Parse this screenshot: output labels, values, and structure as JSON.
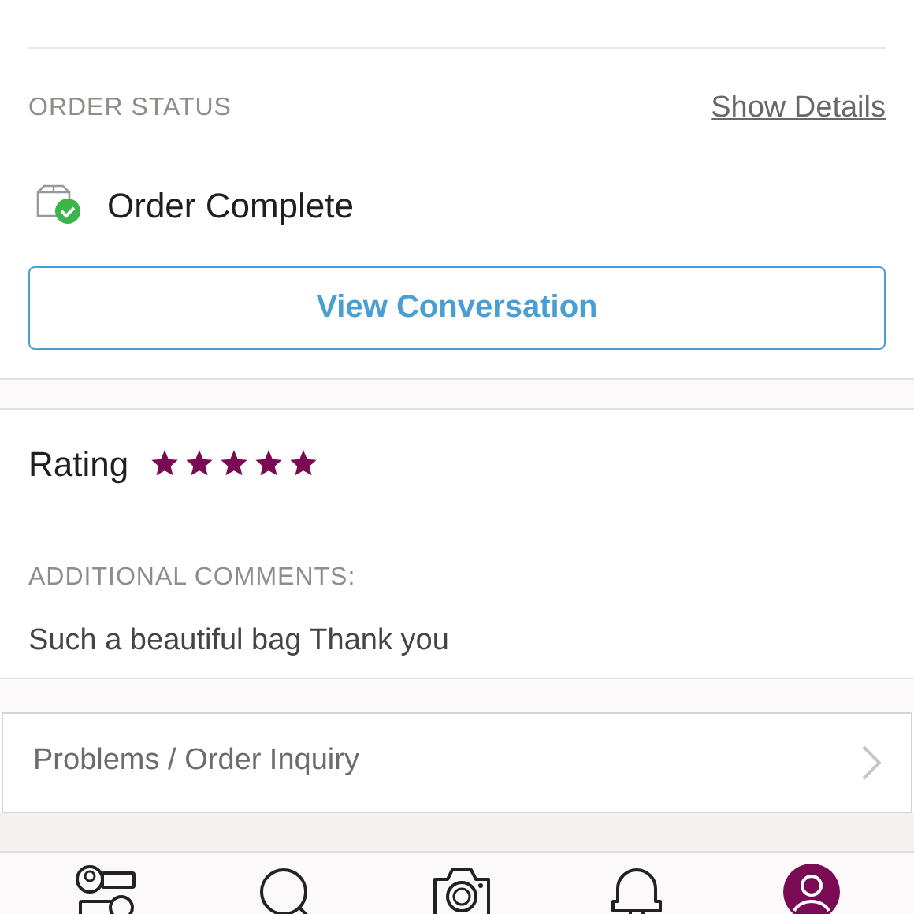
{
  "order_status": {
    "heading": "ORDER STATUS",
    "link": "Show Details",
    "status": "Order Complete",
    "button": "View Conversation"
  },
  "rating": {
    "label": "Rating",
    "stars": 5,
    "comments_heading": "ADDITIONAL COMMENTS:",
    "comment": "Such a beautiful bag Thank you"
  },
  "inquiry": {
    "label": "Problems / Order Inquiry"
  },
  "nav": [
    {
      "kind": "feed",
      "selected": false
    },
    {
      "kind": "search",
      "selected": false
    },
    {
      "kind": "camera",
      "selected": false
    },
    {
      "kind": "bell",
      "selected": false
    },
    {
      "kind": "profile",
      "selected": true
    }
  ]
}
